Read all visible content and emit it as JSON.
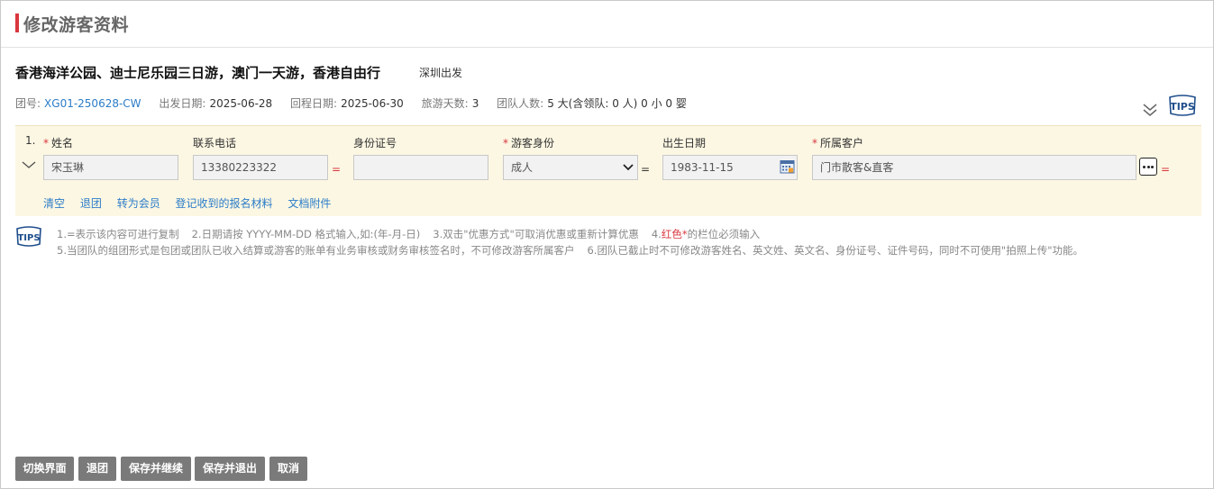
{
  "title": "修改游客资料",
  "tour": {
    "name": "香港海洋公园、迪士尼乐园三日游，澳门一天游，香港自由行",
    "departure_city": "深圳出发"
  },
  "meta": {
    "group_no_label": "团号:",
    "group_no": "XG01-250628-CW",
    "depart_label": "出发日期:",
    "depart_date": "2025-06-28",
    "return_label": "回程日期:",
    "return_date": "2025-06-30",
    "days_label": "旅游天数:",
    "days": "3",
    "people_label": "团队人数:",
    "people": "5 大(含领队: 0 人) 0 小 0 婴"
  },
  "traveler": {
    "index": "1.",
    "name_label": "姓名",
    "name": "宋玉琳",
    "phone_label": "联系电话",
    "phone": "13380223322",
    "id_label": "身份证号",
    "id": "",
    "identity_label": "游客身份",
    "identity": "成人",
    "birth_label": "出生日期",
    "birth": "1983-11-15",
    "customer_label": "所属客户",
    "customer": "门市散客&直客",
    "required_mark": "*",
    "eq": "="
  },
  "actions": [
    "清空",
    "退团",
    "转为会员",
    "登记收到的报名材料",
    "文档附件"
  ],
  "tips": {
    "l1_a": "1.=表示该内容可进行复制",
    "l1_b": "2.日期请按 YYYY-MM-DD 格式输入,如:(年-月-日)",
    "l1_c": "3.双击\"优惠方式\"可取消优惠或重新计算优惠",
    "l1_d_pre": "4.",
    "l1_d_red": "红色*",
    "l1_d_post": "的栏位必须输入",
    "l2_a": "5.当团队的组团形式是包团或团队已收入结算或游客的账单有业务审核或财务审核签名时，不可修改游客所属客户",
    "l2_b": "6.团队已截止时不可修改游客姓名、英文姓、英文名、身份证号、证件号码，同时不可使用\"拍照上传\"功能。"
  },
  "buttons": {
    "switch": "切换界面",
    "withdraw": "退团",
    "save_continue": "保存并继续",
    "save_exit": "保存并退出",
    "cancel": "取消"
  },
  "tips_logo_text": "TIPS",
  "colors": {
    "accent": "#d9363e",
    "link": "#2b7cc8",
    "panel": "#fcf7e3",
    "button": "#7a7a7a"
  }
}
